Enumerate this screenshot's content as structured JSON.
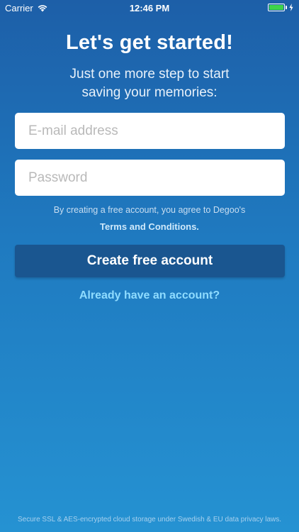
{
  "status_bar": {
    "carrier": "Carrier",
    "time": "12:46 PM",
    "battery_level": 1.0,
    "battery_color": "#3ed44a"
  },
  "header": {
    "title": "Let's get started!",
    "subtitle_line1": "Just one more step to start",
    "subtitle_line2": "saving your memories:"
  },
  "form": {
    "email_placeholder": "E-mail address",
    "email_value": "",
    "password_placeholder": "Password",
    "password_value": ""
  },
  "legal": {
    "agree_text": "By creating a free account, you agree to Degoo's",
    "terms_link": "Terms and Conditions."
  },
  "actions": {
    "create_label": "Create free account",
    "login_link": "Already have an account?"
  },
  "footer": {
    "security_text": "Secure SSL & AES-encrypted cloud storage under Swedish & EU data privacy laws."
  },
  "colors": {
    "accent": "#1a5690",
    "link": "#8fdcff",
    "background_top": "#1d5fa8",
    "background_bottom": "#2592d2"
  },
  "icons": {
    "wifi": "wifi-icon",
    "battery": "battery-icon",
    "charging": "charging-bolt-icon"
  }
}
